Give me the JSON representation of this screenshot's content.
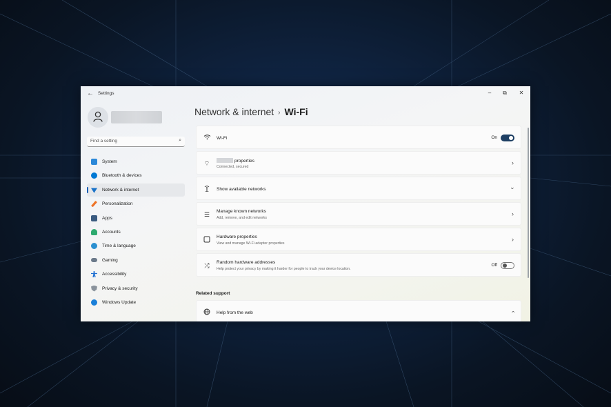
{
  "window": {
    "title": "Settings",
    "back_icon": "arrow-left-icon",
    "controls": [
      "minimize-icon",
      "restore-icon",
      "close-icon"
    ]
  },
  "sidebar": {
    "search_placeholder": "Find a setting",
    "items": [
      {
        "label": "System",
        "icon": "monitor-icon",
        "color": "#2b88d8",
        "active": false
      },
      {
        "label": "Bluetooth & devices",
        "icon": "bluetooth-icon",
        "color": "#0078d4",
        "active": false
      },
      {
        "label": "Network & internet",
        "icon": "wifi-icon",
        "color": "#1a73c8",
        "active": true
      },
      {
        "label": "Personalization",
        "icon": "brush-icon",
        "color": "#e67e22",
        "active": false
      },
      {
        "label": "Apps",
        "icon": "apps-icon",
        "color": "#3a5a80",
        "active": false
      },
      {
        "label": "Accounts",
        "icon": "person-icon",
        "color": "#2eaa6f",
        "active": false
      },
      {
        "label": "Time & language",
        "icon": "globe-clock-icon",
        "color": "#2a8fd0",
        "active": false
      },
      {
        "label": "Gaming",
        "icon": "gamepad-icon",
        "color": "#6b7a8a",
        "active": false
      },
      {
        "label": "Accessibility",
        "icon": "accessibility-icon",
        "color": "#1f6fd1",
        "active": false
      },
      {
        "label": "Privacy & security",
        "icon": "shield-icon",
        "color": "#8a939c",
        "active": false
      },
      {
        "label": "Windows Update",
        "icon": "update-icon",
        "color": "#1a7fd8",
        "active": false
      }
    ]
  },
  "breadcrumb": {
    "parent": "Network & internet",
    "separator": "›",
    "current": "Wi-Fi"
  },
  "cards": {
    "wifi": {
      "title": "Wi-Fi",
      "state": "On",
      "toggle_on": true
    },
    "properties": {
      "title": "properties",
      "subtitle": "Connected, secured"
    },
    "available": {
      "title": "Show available networks"
    },
    "known": {
      "title": "Manage known networks",
      "subtitle": "Add, remove, and edit networks"
    },
    "hardware": {
      "title": "Hardware properties",
      "subtitle": "View and manage Wi-Fi adapter properties"
    },
    "random": {
      "title": "Random hardware addresses",
      "subtitle": "Help protect your privacy by making it harder for people to track your device location.",
      "state": "Off",
      "toggle_on": false
    },
    "help": {
      "title": "Help from the web"
    }
  },
  "related_support": "Related support",
  "colors": {
    "accent": "#1a5fb4",
    "toggle_on": "#1e3f63"
  }
}
